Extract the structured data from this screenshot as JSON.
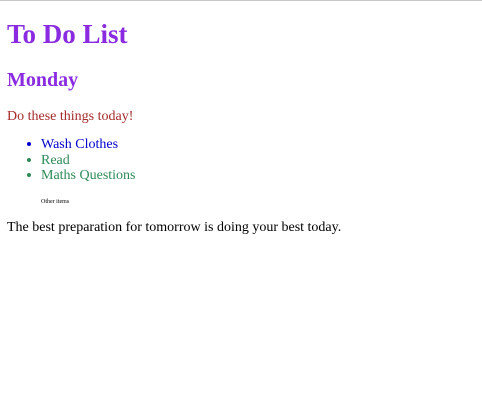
{
  "page": {
    "title": "To Do List",
    "day": "Monday",
    "intro": "Do these things today!",
    "other_items": "Other items",
    "quote": "The best preparation for tomorrow is doing your best today."
  },
  "todo": {
    "items": [
      {
        "label": "Wash Clothes",
        "color": "#0000cc"
      },
      {
        "label": "Read",
        "color": "#2e8b57"
      },
      {
        "label": "Maths Questions",
        "color": "#2e8b57"
      }
    ]
  },
  "colors": {
    "title": "#8a2be2",
    "day": "#8a2be2",
    "intro": "#a52a2a",
    "text": "#000000",
    "background": "#ffffff"
  }
}
